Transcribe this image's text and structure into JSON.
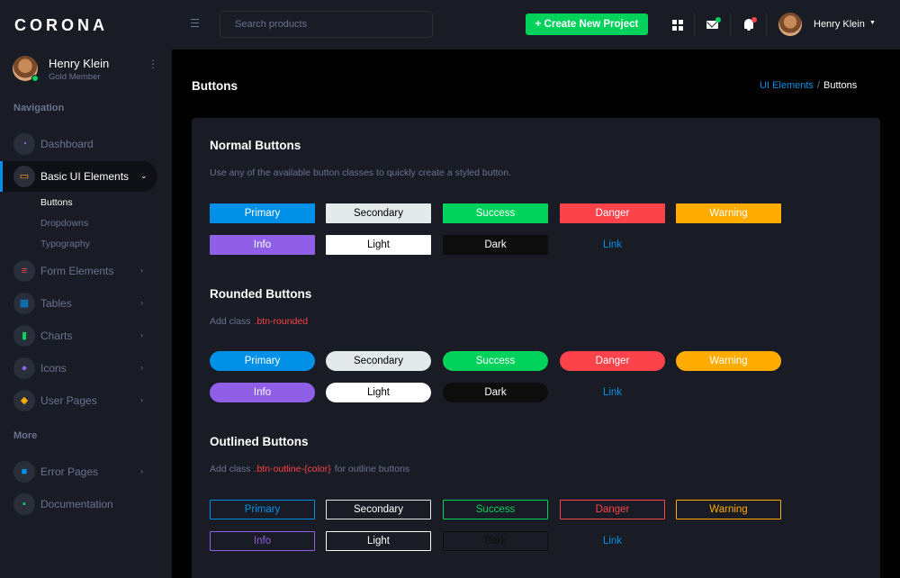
{
  "brand": "CORONA",
  "profile": {
    "name": "Henry Klein",
    "role": "Gold Member"
  },
  "sidebar": {
    "nav_heading": "Navigation",
    "more_heading": "More",
    "items": [
      {
        "label": "Dashboard",
        "icon": "speedometer-icon",
        "icon_color": "#8f5fe8"
      },
      {
        "label": "Basic UI Elements",
        "icon": "laptop-icon",
        "icon_color": "#ffab00"
      },
      {
        "label": "Form Elements",
        "icon": "playlist-icon",
        "icon_color": "#fc424a"
      },
      {
        "label": "Tables",
        "icon": "table-icon",
        "icon_color": "#0090e7"
      },
      {
        "label": "Charts",
        "icon": "chart-bar-icon",
        "icon_color": "#00d25b"
      },
      {
        "label": "Icons",
        "icon": "contacts-icon",
        "icon_color": "#8f5fe8"
      },
      {
        "label": "User Pages",
        "icon": "security-icon",
        "icon_color": "#ffab00"
      },
      {
        "label": "Error Pages",
        "icon": "lock-icon",
        "icon_color": "#0090e7"
      },
      {
        "label": "Documentation",
        "icon": "file-document-icon",
        "icon_color": "#00d25b"
      }
    ],
    "sub_items": [
      "Buttons",
      "Dropdowns",
      "Typography"
    ]
  },
  "topbar": {
    "search_placeholder": "Search products",
    "create_label": "+ Create New Project",
    "user_name": "Henry Klein",
    "mail_badge_color": "#00d25b",
    "bell_badge_color": "#fc424a"
  },
  "page": {
    "title": "Buttons",
    "breadcrumb_link": "UI Elements",
    "breadcrumb_sep": "/",
    "breadcrumb_current": "Buttons"
  },
  "sections": {
    "normal": {
      "title": "Normal Buttons",
      "desc": "Use any of the available button classes to quickly create a styled button."
    },
    "rounded": {
      "title": "Rounded Buttons",
      "desc_prefix": "Add class",
      "desc_code": ".btn-rounded"
    },
    "outlined": {
      "title": "Outlined Buttons",
      "desc_prefix": "Add class",
      "desc_code": ".btn-outline-{color}",
      "desc_suffix": "for outline buttons"
    }
  },
  "buttons": {
    "primary": "Primary",
    "secondary": "Secondary",
    "success": "Success",
    "danger": "Danger",
    "warning": "Warning",
    "info": "Info",
    "light": "Light",
    "dark": "Dark",
    "link": "Link"
  }
}
